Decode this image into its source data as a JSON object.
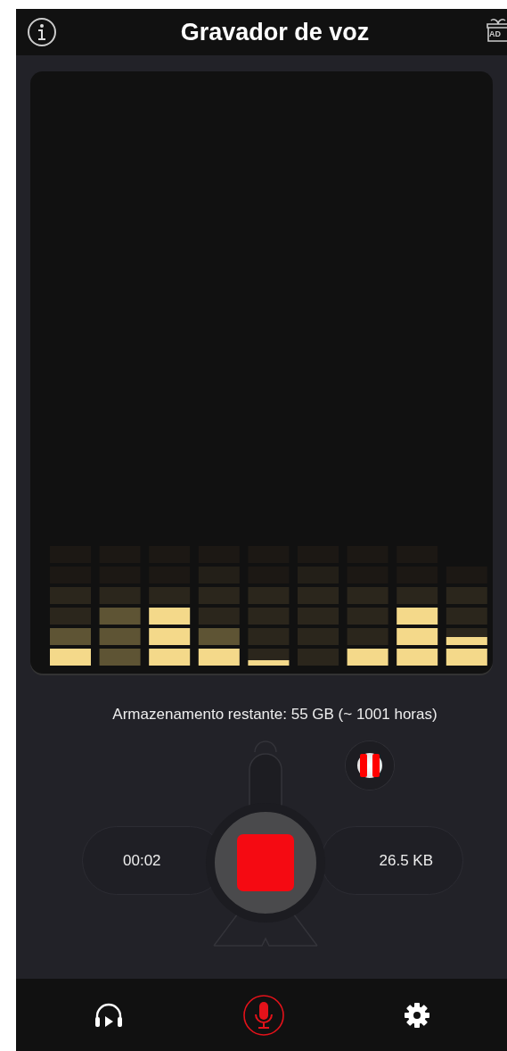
{
  "header": {
    "title": "Gravador de voz",
    "ad_label": "AD"
  },
  "storage": {
    "text": "Armazenamento restante: 55 GB (~ 1001 horas)"
  },
  "recorder": {
    "elapsed": "00:02",
    "size": "26.5 KB"
  },
  "nav": {
    "items": [
      {
        "kind": "player",
        "selected": false
      },
      {
        "kind": "record",
        "selected": true
      },
      {
        "kind": "settings",
        "selected": false
      }
    ]
  }
}
